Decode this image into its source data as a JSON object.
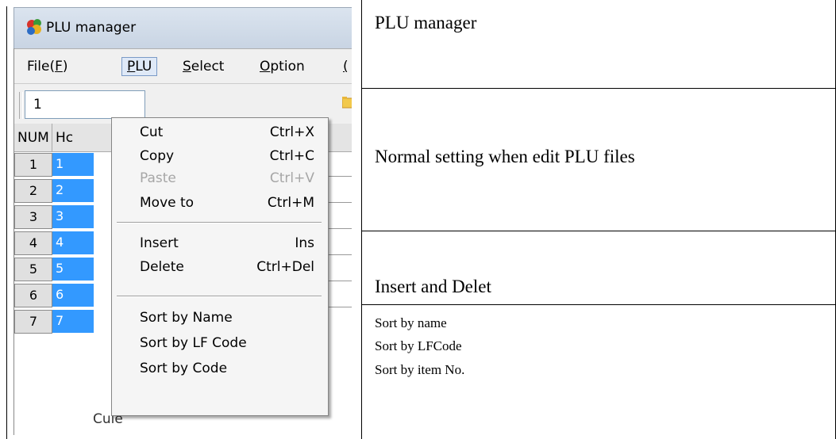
{
  "window": {
    "title": "PLU manager",
    "menus": [
      "File(F)",
      "PLU",
      "Select",
      "Option",
      "("
    ],
    "active_menu": "PLU",
    "toolbar_value": "1"
  },
  "grid": {
    "headers": [
      "NUM",
      "Hc"
    ],
    "rows": [
      "1",
      "2",
      "3",
      "4",
      "5",
      "6",
      "7"
    ],
    "trailing_text": "Cule"
  },
  "plu_menu": {
    "group1": [
      {
        "label": "Cut",
        "shortcut": "Ctrl+X",
        "enabled": true
      },
      {
        "label": "Copy",
        "shortcut": "Ctrl+C",
        "enabled": true
      },
      {
        "label": "Paste",
        "shortcut": "Ctrl+V",
        "enabled": false
      },
      {
        "label": "Move to",
        "shortcut": "Ctrl+M",
        "enabled": true
      }
    ],
    "group2": [
      {
        "label": "Insert",
        "shortcut": "Ins",
        "enabled": true
      },
      {
        "label": "Delete",
        "shortcut": "Ctrl+Del",
        "enabled": true
      }
    ],
    "group3": [
      {
        "label": "Sort by Name",
        "shortcut": "",
        "enabled": true
      },
      {
        "label": "Sort by LF Code",
        "shortcut": "",
        "enabled": true
      },
      {
        "label": "Sort by Code",
        "shortcut": "",
        "enabled": true
      }
    ]
  },
  "descriptions": {
    "row1": "PLU manager",
    "row2": "Normal setting when edit PLU files",
    "row3": "Insert and Delet",
    "row4": [
      "Sort by name",
      "Sort by LFCode",
      "Sort by item No."
    ]
  }
}
